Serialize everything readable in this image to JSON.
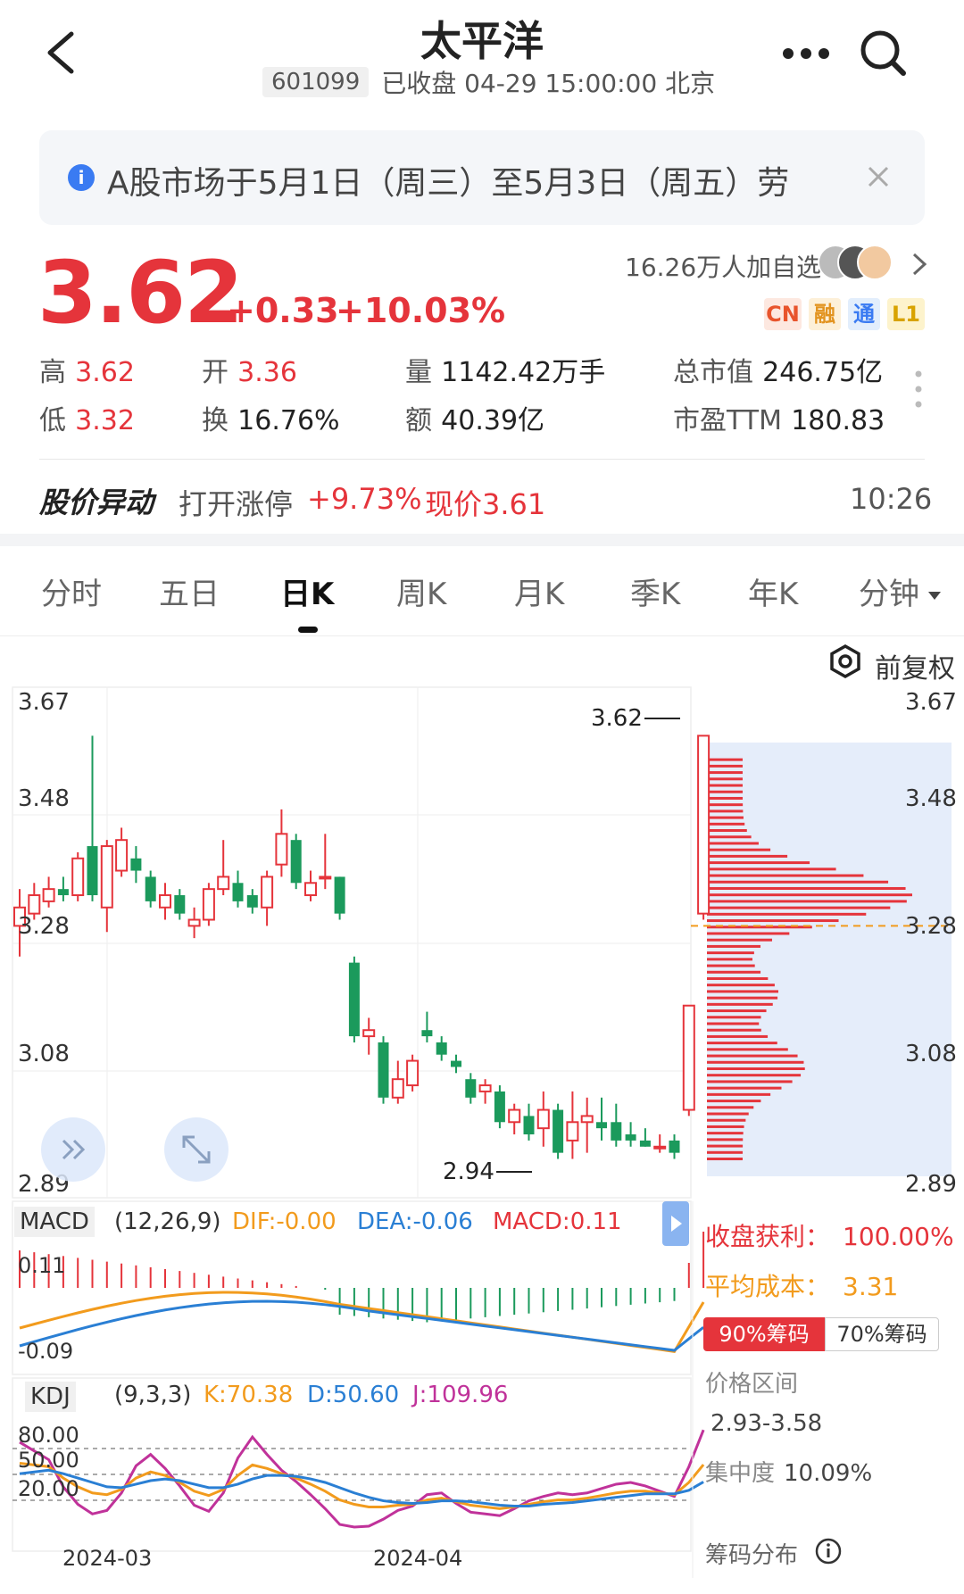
{
  "header": {
    "title": "太平洋",
    "code": "601099",
    "status_time": "已收盘 04-29 15:00:00 北京"
  },
  "notice": {
    "text": "A股市场于5月1日（周三）至5月3日（周五）劳"
  },
  "price": {
    "last": "3.62",
    "change": "+0.33",
    "change_pct": "+10.03%",
    "followers": "16.26万人加自选",
    "tags": [
      "CN",
      "融",
      "通",
      "L1"
    ]
  },
  "stats": {
    "high_label": "高",
    "high": "3.62",
    "open_label": "开",
    "open": "3.36",
    "volume_label": "量",
    "volume": "1142.42万手",
    "mcap_label": "总市值",
    "mcap": "246.75亿",
    "low_label": "低",
    "low": "3.32",
    "turnover_label": "换",
    "turnover": "16.76%",
    "amount_label": "额",
    "amount": "40.39亿",
    "pe_label": "市盈TTM",
    "pe": "180.83"
  },
  "alert": {
    "title": "股价异动",
    "text_prefix": "打开涨停",
    "pct": "+9.73%",
    "now": "现价3.61",
    "time": "10:26"
  },
  "tabs": [
    "分时",
    "五日",
    "日K",
    "周K",
    "月K",
    "季K",
    "年K",
    "分钟"
  ],
  "active_tab": "日K",
  "adjust": "前复权",
  "chart_data": {
    "type": "candlestick",
    "price_axis": [
      "3.67",
      "3.48",
      "3.28",
      "3.08",
      "2.89"
    ],
    "ylim": [
      2.89,
      3.67
    ],
    "x_labels": [
      "2024-03",
      "2024-04"
    ],
    "max_label": "3.62",
    "min_label": "2.94",
    "candles": [
      [
        3.31,
        3.34,
        3.26,
        3.37
      ],
      [
        3.33,
        3.36,
        3.32,
        3.38
      ],
      [
        3.35,
        3.37,
        3.34,
        3.39
      ],
      [
        3.37,
        3.36,
        3.35,
        3.39
      ],
      [
        3.36,
        3.42,
        3.35,
        3.43
      ],
      [
        3.44,
        3.36,
        3.35,
        3.62
      ],
      [
        3.34,
        3.44,
        3.3,
        3.45
      ],
      [
        3.4,
        3.45,
        3.39,
        3.47
      ],
      [
        3.42,
        3.4,
        3.38,
        3.44
      ],
      [
        3.39,
        3.35,
        3.34,
        3.4
      ],
      [
        3.34,
        3.36,
        3.32,
        3.38
      ],
      [
        3.36,
        3.33,
        3.32,
        3.37
      ],
      [
        3.31,
        3.32,
        3.29,
        3.34
      ],
      [
        3.32,
        3.37,
        3.31,
        3.38
      ],
      [
        3.37,
        3.39,
        3.36,
        3.45
      ],
      [
        3.38,
        3.35,
        3.34,
        3.4
      ],
      [
        3.36,
        3.34,
        3.33,
        3.37
      ],
      [
        3.34,
        3.39,
        3.31,
        3.4
      ],
      [
        3.41,
        3.46,
        3.39,
        3.5
      ],
      [
        3.45,
        3.38,
        3.37,
        3.46
      ],
      [
        3.36,
        3.38,
        3.35,
        3.4
      ],
      [
        3.39,
        3.39,
        3.37,
        3.46
      ],
      [
        3.39,
        3.33,
        3.32,
        3.39
      ],
      [
        3.25,
        3.13,
        3.12,
        3.26
      ],
      [
        3.13,
        3.14,
        3.1,
        3.16
      ],
      [
        3.12,
        3.03,
        3.02,
        3.13
      ],
      [
        3.03,
        3.06,
        3.02,
        3.09
      ],
      [
        3.05,
        3.09,
        3.04,
        3.1
      ],
      [
        3.14,
        3.13,
        3.12,
        3.17
      ],
      [
        3.12,
        3.1,
        3.09,
        3.13
      ],
      [
        3.09,
        3.08,
        3.07,
        3.1
      ],
      [
        3.06,
        3.03,
        3.02,
        3.07
      ],
      [
        3.04,
        3.05,
        3.02,
        3.06
      ],
      [
        3.04,
        2.99,
        2.98,
        3.05
      ],
      [
        2.99,
        3.01,
        2.97,
        3.02
      ],
      [
        3.0,
        2.97,
        2.96,
        3.02
      ],
      [
        2.98,
        3.01,
        2.95,
        3.04
      ],
      [
        3.01,
        2.94,
        2.93,
        3.02
      ],
      [
        2.96,
        2.99,
        2.93,
        3.04
      ],
      [
        2.99,
        3.0,
        2.94,
        3.03
      ],
      [
        2.99,
        2.98,
        2.96,
        3.03
      ],
      [
        2.99,
        2.96,
        2.95,
        3.02
      ],
      [
        2.97,
        2.96,
        2.95,
        2.99
      ],
      [
        2.96,
        2.95,
        2.95,
        2.98
      ],
      [
        2.95,
        2.95,
        2.94,
        2.97
      ],
      [
        2.96,
        2.94,
        2.93,
        2.97
      ],
      [
        3.01,
        3.18,
        3.0,
        3.18
      ],
      [
        3.33,
        3.62,
        3.32,
        3.62
      ]
    ]
  },
  "macd": {
    "label": "MACD",
    "params": "(12,26,9)",
    "dif": "DIF:-0.00",
    "dea": "DEA:-0.06",
    "macd": "MACD:0.11",
    "max": "0.11",
    "min": "-0.09"
  },
  "kdj": {
    "label": "KDJ",
    "params": "(9,3,3)",
    "k": "K:70.38",
    "d": "D:50.60",
    "j": "J:109.96",
    "levels": [
      "80.00",
      "50.00",
      "20.00"
    ]
  },
  "chips": {
    "profit_label": "收盘获利：",
    "profit": "100.00%",
    "avg_label": "平均成本：",
    "avg": "3.31",
    "btn_90": "90%筹码",
    "btn_70": "70%筹码",
    "range_label": "价格区间",
    "range": "2.93-3.58",
    "conc_label": "集中度",
    "conc": "10.09%",
    "dist_label": "筹码分布"
  },
  "colors": {
    "up": "#e5343b",
    "down": "#1b9a5c",
    "dif": "#f29b1d",
    "dea": "#2a7fd4",
    "j": "#c0329a"
  }
}
